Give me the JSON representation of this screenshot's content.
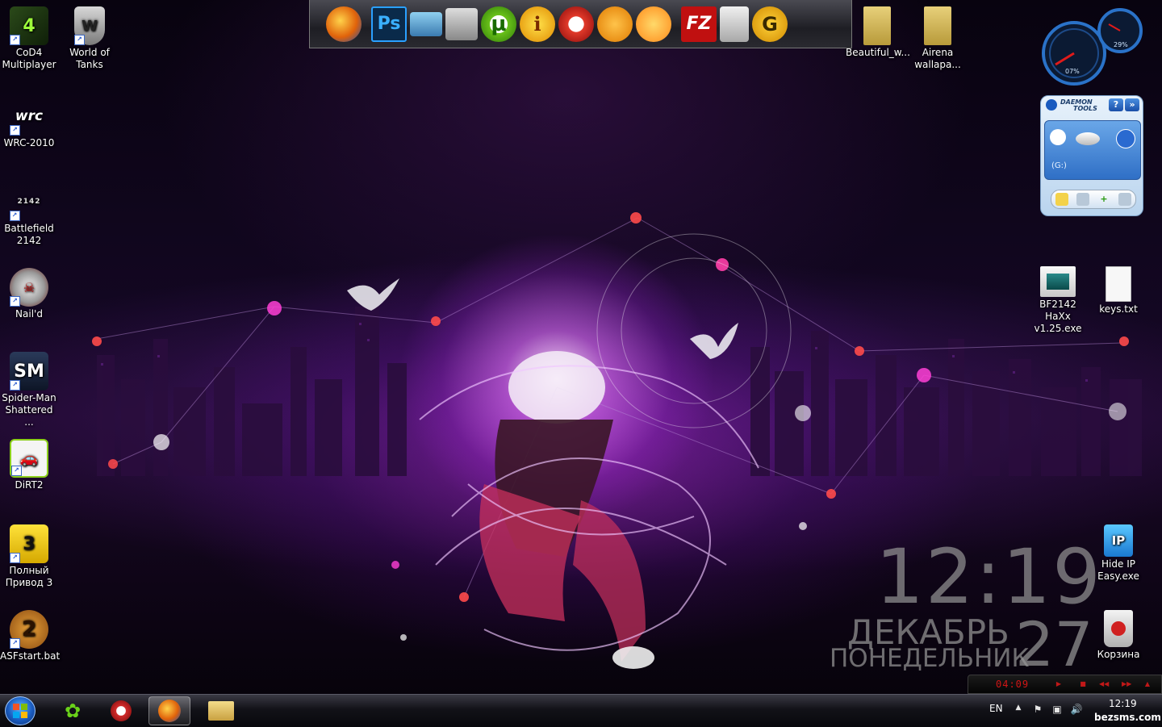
{
  "desktop": {
    "left_icons": [
      {
        "label": "CoD4 Multiplayer",
        "icon": "cod4-icon"
      },
      {
        "label": "WRC-2010",
        "icon": "wrc-icon"
      },
      {
        "label": "Battlefield 2142",
        "icon": "battlefield-icon"
      },
      {
        "label": "Nail'd",
        "icon": "naild-icon"
      },
      {
        "label": "Spider-Man Shattered ...",
        "icon": "spiderman-icon"
      },
      {
        "label": "DiRT2",
        "icon": "dirt2-icon"
      },
      {
        "label": "Полный Привод 3",
        "icon": "polny-privod-icon"
      },
      {
        "label": "ASFstart.bat",
        "icon": "asfstart-icon"
      }
    ],
    "second_col_icons": [
      {
        "label": "World of Tanks",
        "icon": "world-of-tanks-icon"
      }
    ],
    "top_folders": [
      {
        "label": "Beautiful_w...",
        "icon": "folder-icon"
      },
      {
        "label": "Airena wallapa...",
        "icon": "folder-icon"
      }
    ],
    "right_icons": [
      {
        "label": "BF2142 HaXx v1.25.exe",
        "icon": "exe-icon"
      },
      {
        "label": "keys.txt",
        "icon": "text-file-icon"
      },
      {
        "label": "Hide IP Easy.exe",
        "icon": "hide-ip-icon"
      },
      {
        "label": "Корзина",
        "icon": "recycle-bin-icon"
      }
    ],
    "shortcut_arrow": "↗"
  },
  "dock": {
    "items": [
      {
        "name": "firefox-icon",
        "glyph": ""
      },
      {
        "name": "photoshop-icon",
        "glyph": "Ps"
      },
      {
        "name": "monitor-icon",
        "glyph": ""
      },
      {
        "name": "calculator-icon",
        "glyph": ""
      },
      {
        "name": "utorrent-icon",
        "glyph": "µ"
      },
      {
        "name": "info-icon",
        "glyph": "i"
      },
      {
        "name": "burn-icon",
        "glyph": ""
      },
      {
        "name": "aimp-icon",
        "glyph": ""
      },
      {
        "name": "gom-player-icon",
        "glyph": ""
      },
      {
        "name": "filezilla-icon",
        "glyph": "FZ"
      },
      {
        "name": "trash-icon",
        "glyph": ""
      },
      {
        "name": "ccleaner-icon",
        "glyph": "G"
      }
    ]
  },
  "gauges": {
    "cpu_percent": "07%",
    "ram_percent": "29%"
  },
  "daemon_tools": {
    "title_line1": "DAEMON",
    "title_line2": "TOOLS",
    "help_label": "?",
    "drive_label": "(G:)"
  },
  "clock_widget": {
    "time": "12:19",
    "month": "ДЕКАБРЬ",
    "weekday": "ПОНЕДЕЛЬНИК",
    "date": "27"
  },
  "media_player": {
    "time": "04:09"
  },
  "taskbar": {
    "language": "EN",
    "time": "12:19",
    "pinned": [
      "icq-icon",
      "nero-icon",
      "firefox-icon",
      "explorer-icon"
    ]
  },
  "watermark": "bezsms.com",
  "colors": {
    "accent_purple": "#9b30d9",
    "player_red": "#d01515",
    "taskbar_bg": "#101016"
  }
}
